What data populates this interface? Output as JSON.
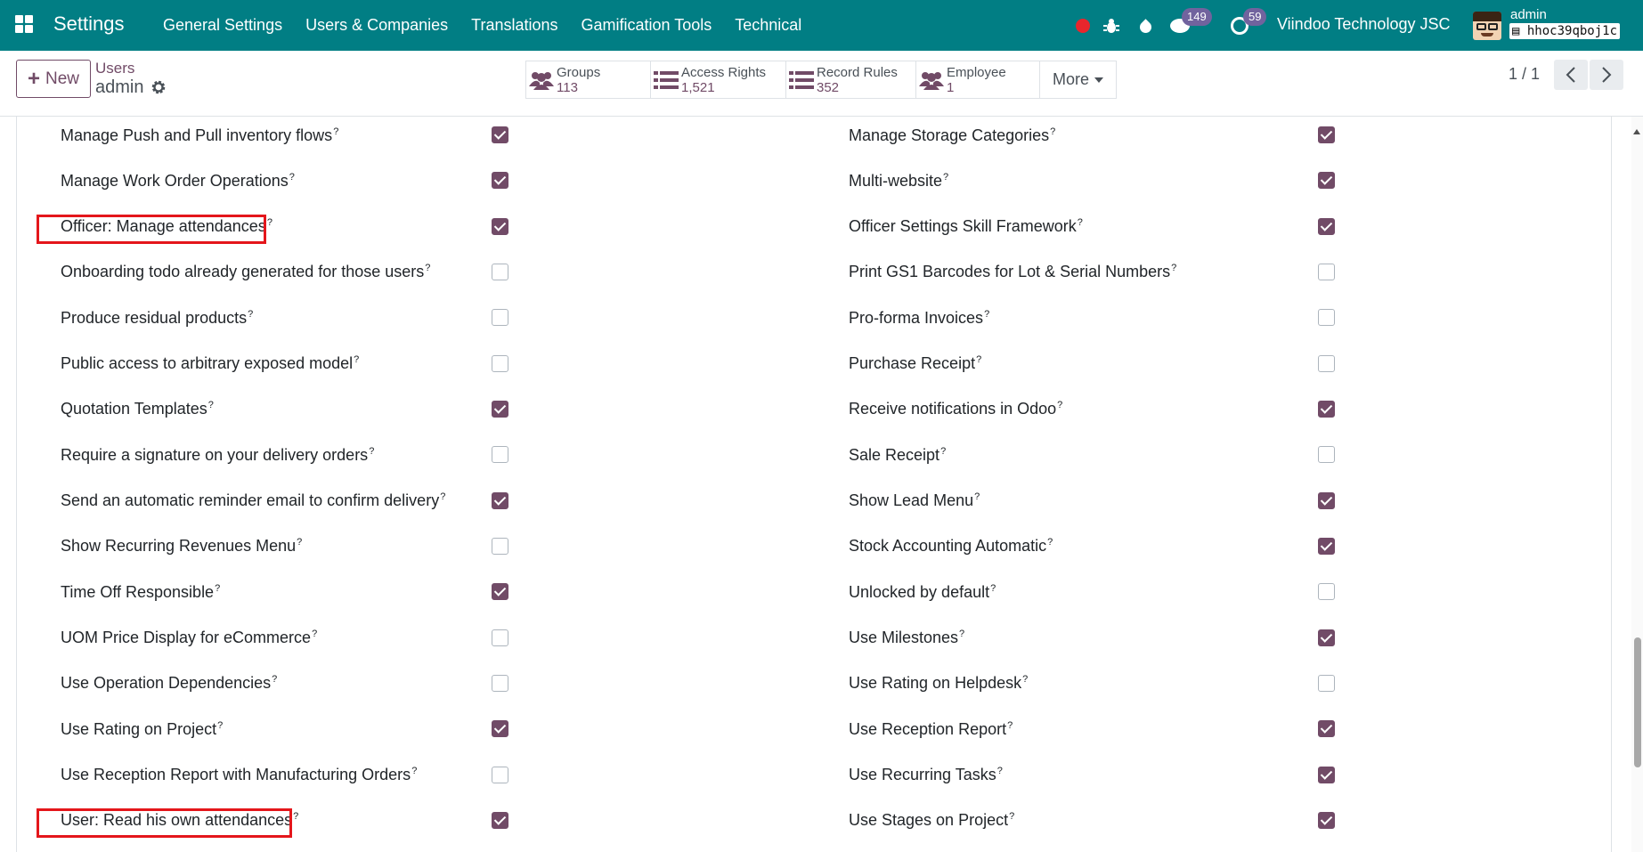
{
  "navbar": {
    "app_name": "Settings",
    "menu": [
      "General Settings",
      "Users & Companies",
      "Translations",
      "Gamification Tools",
      "Technical"
    ],
    "messages_count": "149",
    "activities_count": "59",
    "company": "Viindoo Technology JSC",
    "user": "admin",
    "database": "hhoc39qboj1c",
    "accent": "#017e84",
    "record_dot_color": "#e8262c"
  },
  "control": {
    "new_label": "New",
    "breadcrumb_parent": "Users",
    "breadcrumb_current": "admin",
    "stats": {
      "groups": {
        "label": "Groups",
        "value": "113"
      },
      "access": {
        "label": "Access Rights",
        "value": "1,521"
      },
      "rules": {
        "label": "Record Rules",
        "value": "352"
      },
      "employee": {
        "label": "Employee",
        "value": "1"
      }
    },
    "more_label": "More",
    "pager": "1 / 1"
  },
  "rights": {
    "left": [
      {
        "label": "Manage Push and Pull inventory flows",
        "checked": true
      },
      {
        "label": "Manage Work Order Operations",
        "checked": true
      },
      {
        "label": "Officer: Manage attendances",
        "checked": true,
        "highlighted": true
      },
      {
        "label": "Onboarding todo already generated for those users",
        "checked": false
      },
      {
        "label": "Produce residual products",
        "checked": false
      },
      {
        "label": "Public access to arbitrary exposed model",
        "checked": false
      },
      {
        "label": "Quotation Templates",
        "checked": true
      },
      {
        "label": "Require a signature on your delivery orders",
        "checked": false
      },
      {
        "label": "Send an automatic reminder email to confirm delivery",
        "checked": true
      },
      {
        "label": "Show Recurring Revenues Menu",
        "checked": false
      },
      {
        "label": "Time Off Responsible",
        "checked": true
      },
      {
        "label": "UOM Price Display for eCommerce",
        "checked": false
      },
      {
        "label": "Use Operation Dependencies",
        "checked": false
      },
      {
        "label": "Use Rating on Project",
        "checked": true
      },
      {
        "label": "Use Reception Report with Manufacturing Orders",
        "checked": false
      },
      {
        "label": "User: Read his own attendances",
        "checked": true,
        "highlighted": true
      }
    ],
    "right": [
      {
        "label": "Manage Storage Categories",
        "checked": true
      },
      {
        "label": "Multi-website",
        "checked": true
      },
      {
        "label": "Officer Settings Skill Framework",
        "checked": true
      },
      {
        "label": "Print GS1 Barcodes for Lot & Serial Numbers",
        "checked": false
      },
      {
        "label": "Pro-forma Invoices",
        "checked": false
      },
      {
        "label": "Purchase Receipt",
        "checked": false
      },
      {
        "label": "Receive notifications in Odoo",
        "checked": true
      },
      {
        "label": "Sale Receipt",
        "checked": false
      },
      {
        "label": "Show Lead Menu",
        "checked": true
      },
      {
        "label": "Stock Accounting Automatic",
        "checked": true
      },
      {
        "label": "Unlocked by default",
        "checked": false
      },
      {
        "label": "Use Milestones",
        "checked": true
      },
      {
        "label": "Use Rating on Helpdesk",
        "checked": false
      },
      {
        "label": "Use Reception Report",
        "checked": true
      },
      {
        "label": "Use Recurring Tasks",
        "checked": true
      },
      {
        "label": "Use Stages on Project",
        "checked": true
      }
    ],
    "help_marker": "?",
    "checkbox_color": "#714b67",
    "highlight_color": "#e4161b"
  }
}
